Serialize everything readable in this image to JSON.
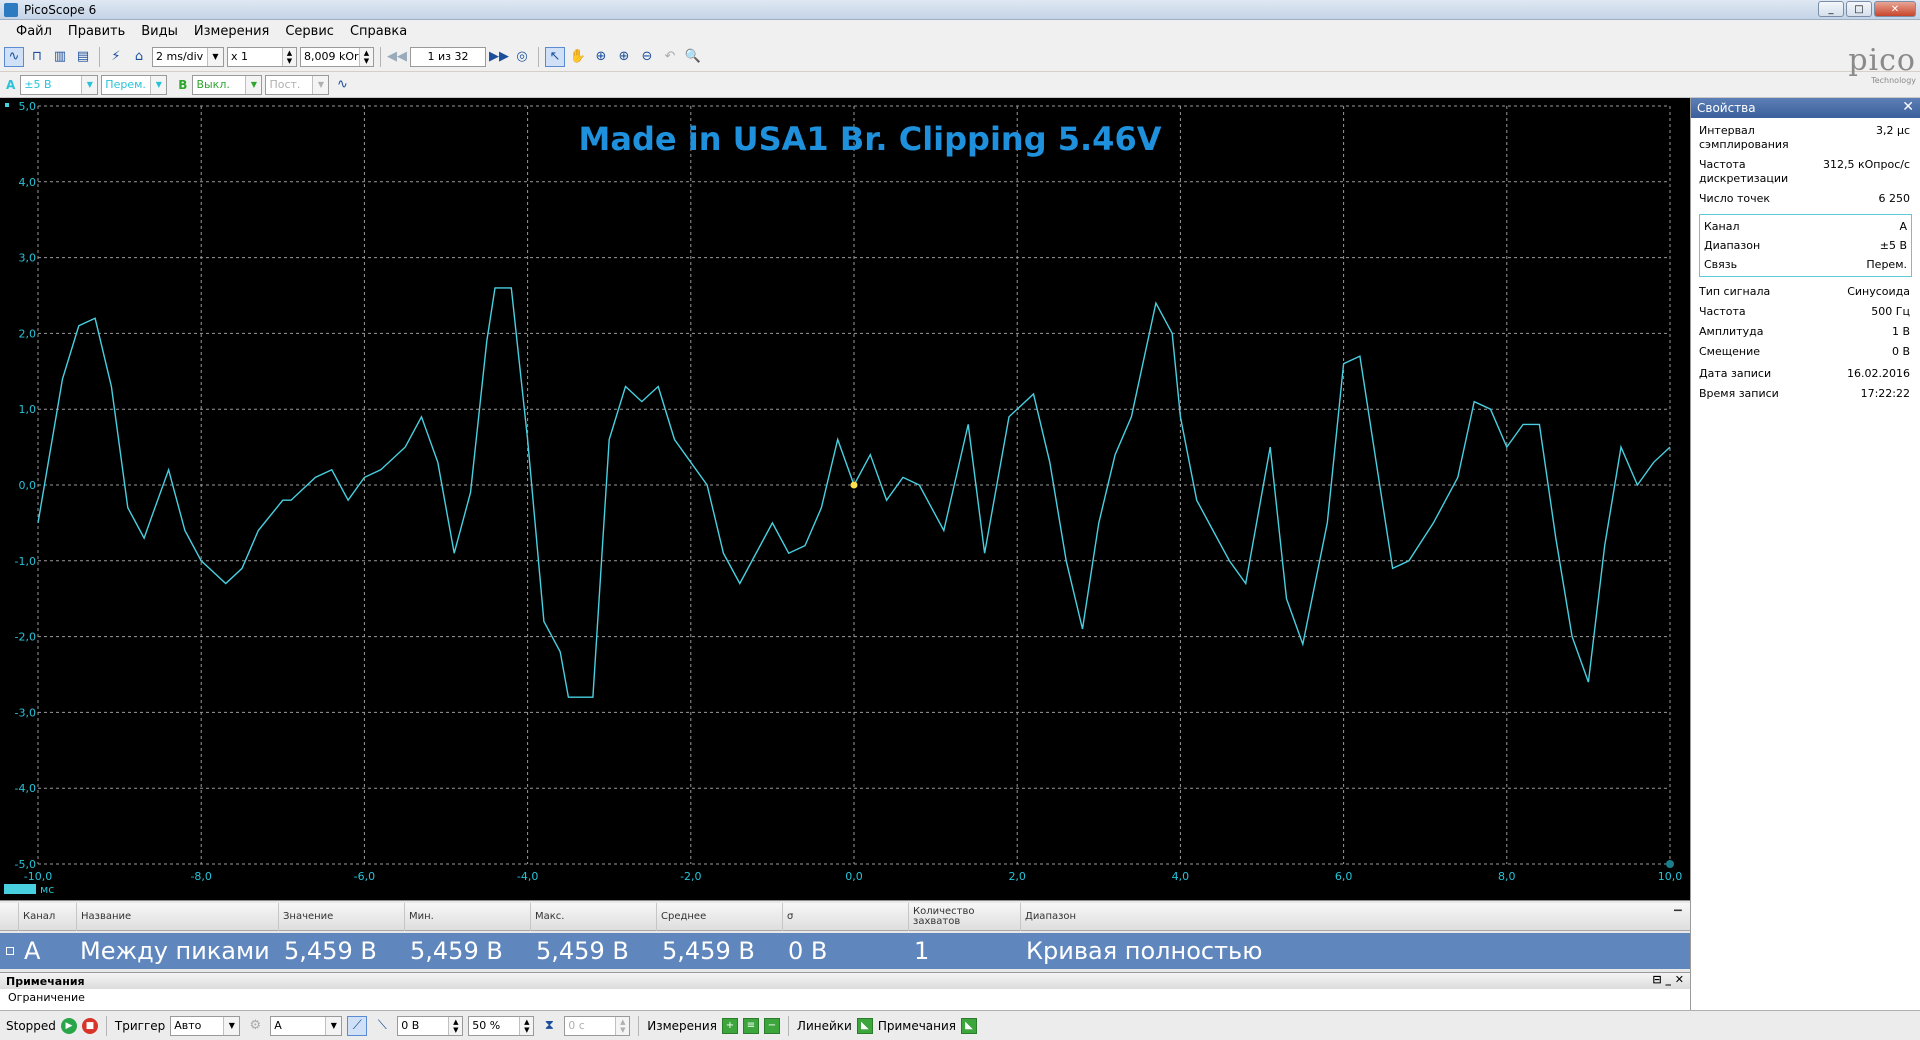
{
  "window": {
    "title": "PicoScope 6",
    "min": "_",
    "max": "□",
    "close": "✕"
  },
  "menu": [
    "Файл",
    "Править",
    "Виды",
    "Измерения",
    "Сервис",
    "Справка"
  ],
  "toolbar": {
    "timebase": "2 ms/div",
    "zoom": "x 1",
    "samples": "8,009 kOr",
    "capture_nav": "1 из 32"
  },
  "channels": {
    "a": {
      "label": "A",
      "range": "±5 В",
      "coupling": "Перем."
    },
    "b": {
      "label": "B",
      "range": "Выкл.",
      "coupling": "Пост."
    }
  },
  "logo": {
    "text": "pico",
    "sub": "Technology"
  },
  "scope": {
    "title": "Made in USA1 Br. Clipping 5.46V",
    "unit_label": "мс",
    "trace_color": "#48d0e0",
    "title_color": "#1e90dc"
  },
  "chart_data": {
    "type": "line",
    "title": "Made in USA1 Br. Clipping 5.46V",
    "xlabel": "мс",
    "ylabel": "",
    "xlim": [
      -10,
      10
    ],
    "ylim": [
      -5,
      5
    ],
    "grid": true,
    "x_ticks": [
      "-10,0",
      "-8,0",
      "-6,0",
      "-4,0",
      "-2,0",
      "0,0",
      "2,0",
      "4,0",
      "6,0",
      "8,0",
      "10,0"
    ],
    "y_ticks": [
      "5,0",
      "4,0",
      "3,0",
      "2,0",
      "1,0",
      "0,0",
      "-1,0",
      "-2,0",
      "-3,0",
      "-4,0",
      "-5,0"
    ],
    "series": [
      {
        "name": "A",
        "x": [
          -10.0,
          -9.7,
          -9.5,
          -9.3,
          -9.1,
          -8.9,
          -8.7,
          -8.6,
          -8.4,
          -8.2,
          -8.0,
          -7.9,
          -7.7,
          -7.5,
          -7.3,
          -7.0,
          -6.9,
          -6.6,
          -6.4,
          -6.2,
          -6.0,
          -5.8,
          -5.5,
          -5.3,
          -5.1,
          -4.9,
          -4.7,
          -4.5,
          -4.4,
          -4.2,
          -4.0,
          -3.8,
          -3.6,
          -3.5,
          -3.4,
          -3.2,
          -3.0,
          -2.8,
          -2.6,
          -2.4,
          -2.2,
          -2.0,
          -1.8,
          -1.6,
          -1.4,
          -1.0,
          -0.8,
          -0.6,
          -0.4,
          -0.2,
          0.0,
          0.2,
          0.4,
          0.6,
          0.8,
          1.1,
          1.4,
          1.6,
          1.9,
          2.2,
          2.4,
          2.6,
          2.8,
          3.0,
          3.2,
          3.4,
          3.7,
          3.9,
          4.0,
          4.2,
          4.4,
          4.6,
          4.8,
          5.1,
          5.3,
          5.5,
          5.8,
          6.0,
          6.2,
          6.4,
          6.6,
          6.8,
          7.1,
          7.4,
          7.6,
          7.8,
          8.0,
          8.2,
          8.4,
          8.6,
          8.8,
          9.0,
          9.2,
          9.4,
          9.6,
          9.8,
          10.0
        ],
        "y": [
          -0.5,
          1.4,
          2.1,
          2.2,
          1.3,
          -0.3,
          -0.7,
          -0.4,
          0.2,
          -0.6,
          -1.0,
          -1.1,
          -1.3,
          -1.1,
          -0.6,
          -0.2,
          -0.2,
          0.1,
          0.2,
          -0.2,
          0.1,
          0.2,
          0.5,
          0.9,
          0.3,
          -0.9,
          -0.1,
          1.9,
          2.6,
          2.6,
          0.6,
          -1.8,
          -2.2,
          -2.8,
          -2.8,
          -2.8,
          0.6,
          1.3,
          1.1,
          1.3,
          0.6,
          0.3,
          0.0,
          -0.9,
          -1.3,
          -0.5,
          -0.9,
          -0.8,
          -0.3,
          0.6,
          0.0,
          0.4,
          -0.2,
          0.1,
          0.0,
          -0.6,
          0.8,
          -0.9,
          0.9,
          1.2,
          0.3,
          -1.0,
          -1.9,
          -0.5,
          0.4,
          0.9,
          2.4,
          2.0,
          0.9,
          -0.2,
          -0.6,
          -1.0,
          -1.3,
          0.5,
          -1.5,
          -2.1,
          -0.5,
          1.6,
          1.7,
          0.3,
          -1.1,
          -1.0,
          -0.5,
          0.1,
          1.1,
          1.0,
          0.5,
          0.8,
          0.8,
          -0.7,
          -2.0,
          -2.6,
          -0.8,
          0.5,
          0.0,
          0.3,
          0.5
        ]
      }
    ]
  },
  "properties": {
    "header": "Свойства",
    "close": "✕",
    "rows1": [
      {
        "k": "Интервал сэмплирования",
        "v": "3,2 µс"
      },
      {
        "k": "Частота дискретизации",
        "v": "312,5 кОпрос/с"
      },
      {
        "k": "Число точек",
        "v": "6 250"
      }
    ],
    "channel_box": [
      {
        "k": "Канал",
        "v": "A"
      },
      {
        "k": "Диапазон",
        "v": "±5 В"
      },
      {
        "k": "Связь",
        "v": "Перем."
      }
    ],
    "rows2": [
      {
        "k": "Тип сигнала",
        "v": "Синусоида"
      },
      {
        "k": "Частота",
        "v": "500 Гц"
      },
      {
        "k": "Амплитуда",
        "v": "1 В"
      },
      {
        "k": "Смещение",
        "v": "0 В"
      }
    ],
    "rows3": [
      {
        "k": "Дата записи",
        "v": "16.02.2016"
      },
      {
        "k": "Время записи",
        "v": "17:22:22"
      }
    ]
  },
  "measurements": {
    "headers": [
      "Канал",
      "Название",
      "Значение",
      "Мин.",
      "Макс.",
      "Среднее",
      "σ",
      "Количество захватов",
      "Диапазон"
    ],
    "row": [
      "A",
      "Между пиками",
      "5,459 В",
      "5,459 В",
      "5,459 В",
      "5,459 В",
      "0 В",
      "1",
      "Кривая полностью"
    ]
  },
  "notes": {
    "title": "Примечания",
    "text": "Ограничение",
    "ctrls": "⊟ _ ✕"
  },
  "status": {
    "stopped": "Stopped",
    "trigger_label": "Триггер",
    "trigger_mode": "Авто",
    "trigger_channel": "A",
    "trigger_level": "0 В",
    "pretrigger": "50 %",
    "delay": "0 с",
    "measurements": "Измерения",
    "rulers": "Линейки",
    "notes": "Примечания"
  }
}
